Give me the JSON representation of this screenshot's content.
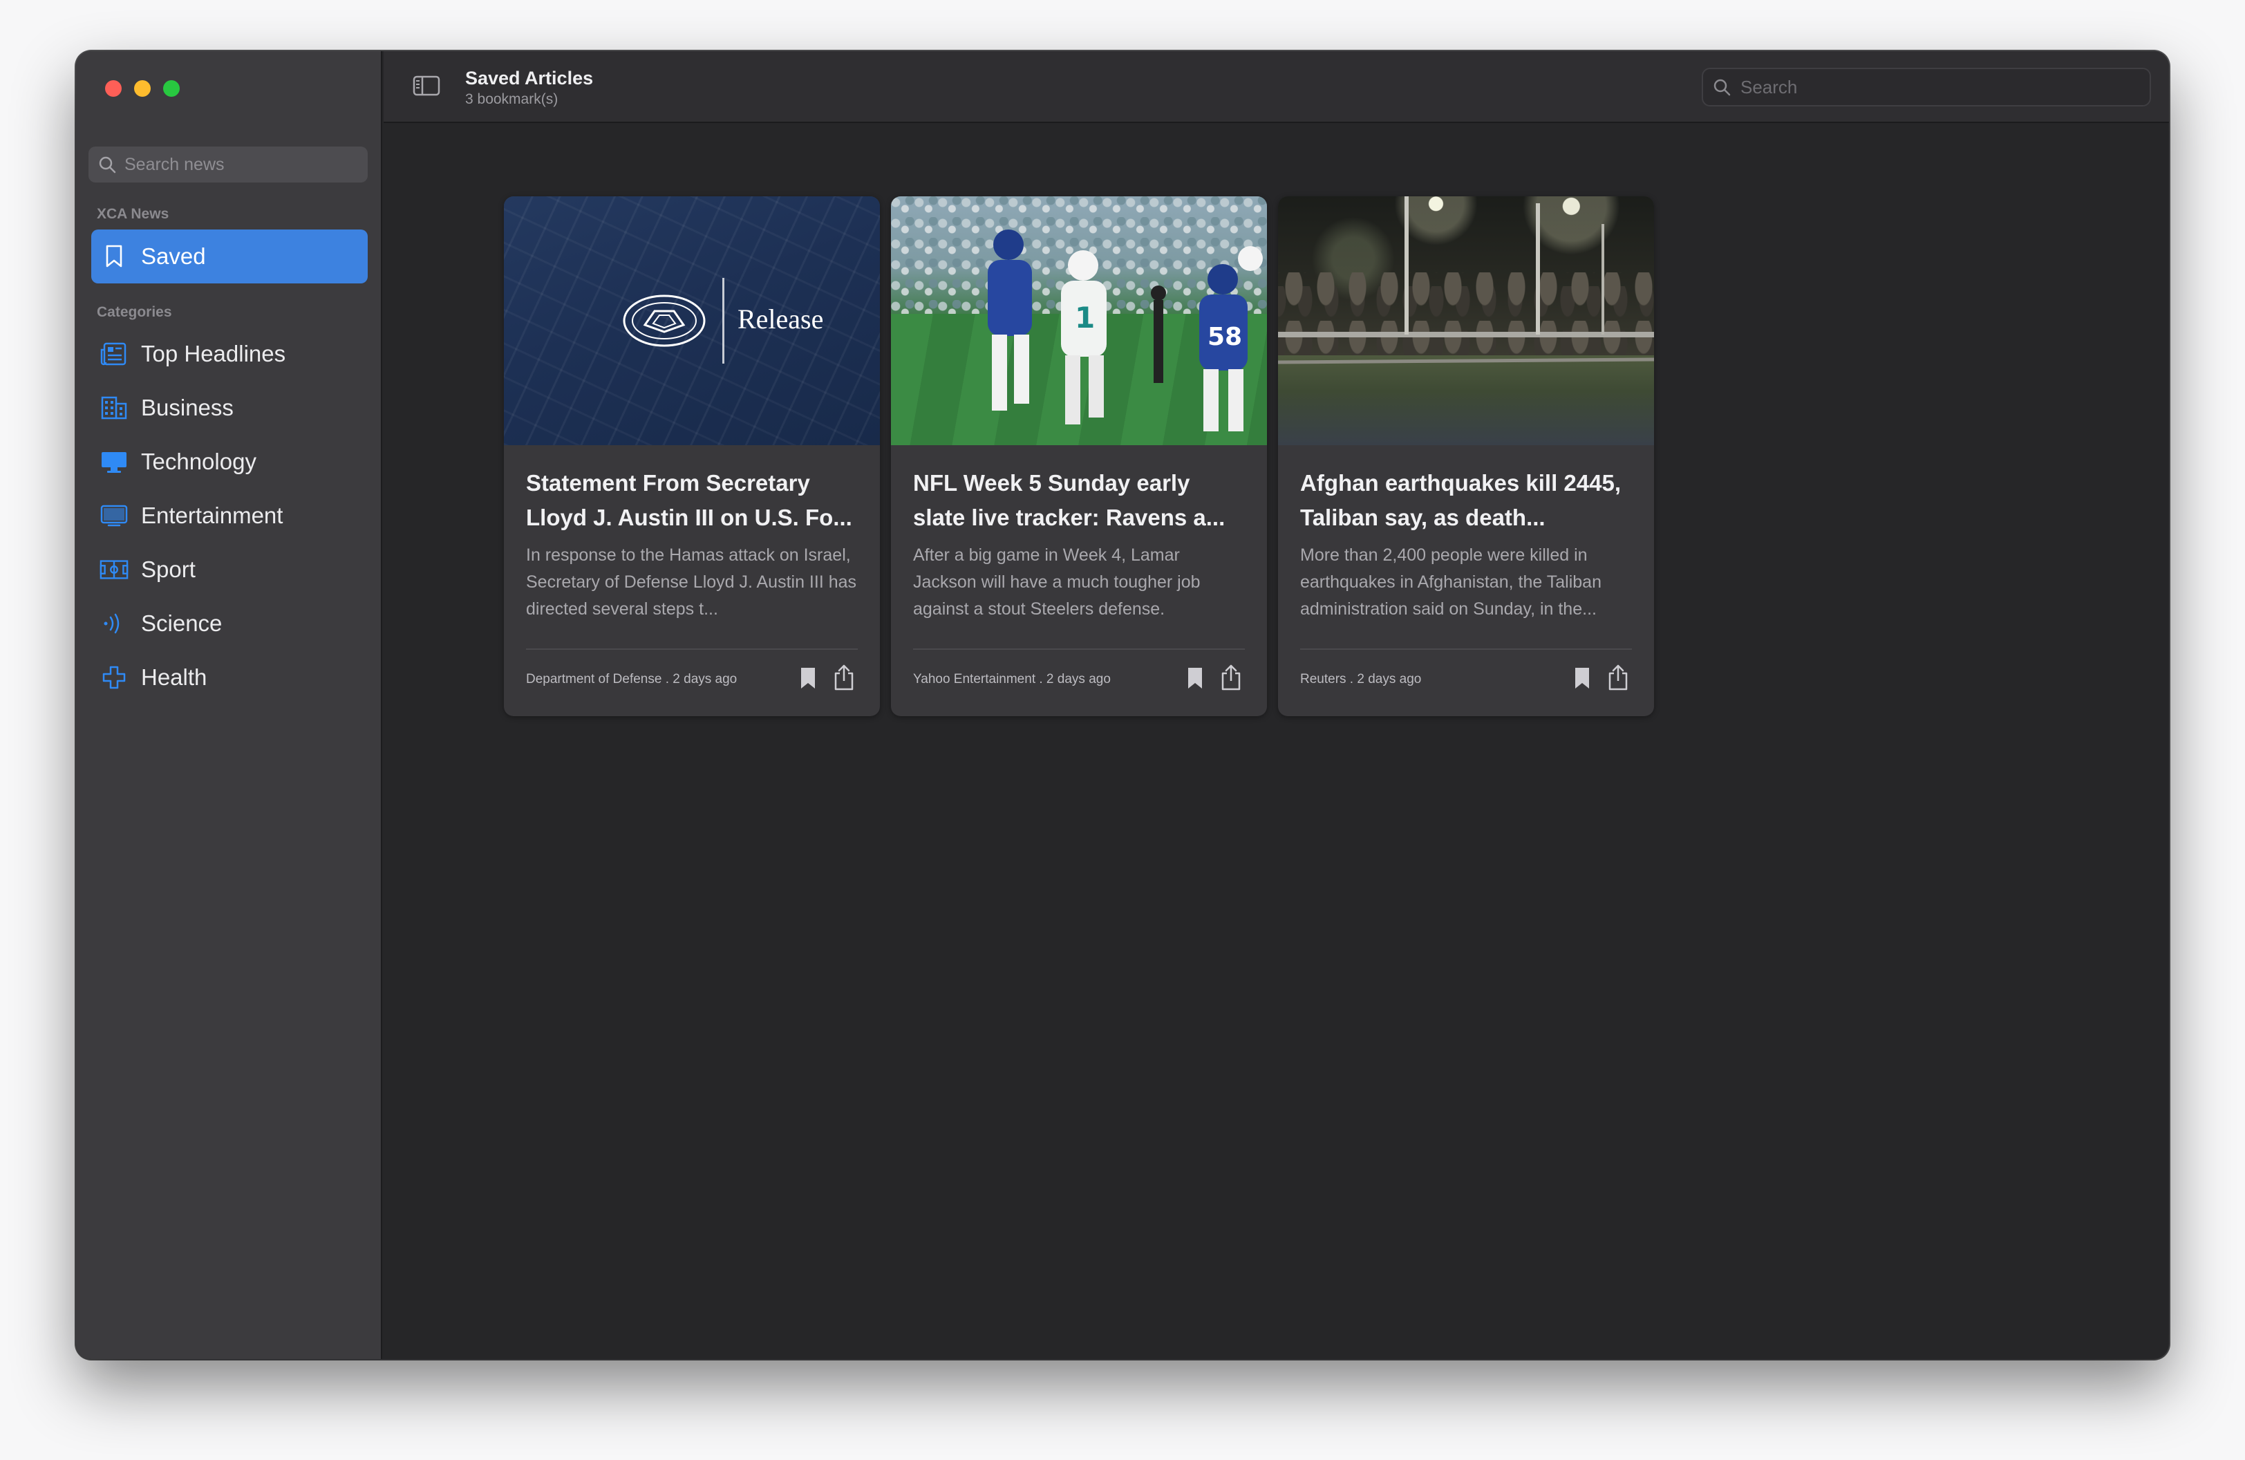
{
  "sidebar": {
    "search_placeholder": "Search news",
    "section_app": "XCA News",
    "saved_label": "Saved",
    "section_categories": "Categories",
    "categories": [
      {
        "label": "Top Headlines",
        "icon": "newspaper-icon"
      },
      {
        "label": "Business",
        "icon": "building-icon"
      },
      {
        "label": "Technology",
        "icon": "desktop-icon"
      },
      {
        "label": "Entertainment",
        "icon": "tv-icon"
      },
      {
        "label": "Sport",
        "icon": "sport-field-icon"
      },
      {
        "label": "Science",
        "icon": "wave-icon"
      },
      {
        "label": "Health",
        "icon": "cross-icon"
      }
    ]
  },
  "toolbar": {
    "title": "Saved Articles",
    "subtitle": "3 bookmark(s)",
    "search_placeholder": "Search"
  },
  "articles": [
    {
      "title": "Statement From Secretary Lloyd J. Austin III on U.S. Fo...",
      "description": "In response to the Hamas attack on Israel, Secretary of Defense Lloyd J. Austin III has directed several steps t...",
      "meta": "Department of Defense . 2 days ago",
      "image_text": "Release"
    },
    {
      "title": "NFL Week 5 Sunday early slate live tracker: Ravens a...",
      "description": "After a big game in Week 4, Lamar Jackson will have a much tougher job against a stout Steelers defense.",
      "meta": "Yahoo Entertainment . 2 days ago"
    },
    {
      "title": "Afghan earthquakes kill 2445, Taliban say, as death...",
      "description": "More than 2,400 people were killed in earthquakes in Afghanistan, the Taliban administration said on Sunday, in the...",
      "meta": "Reuters . 2 days ago"
    }
  ],
  "colors": {
    "accent": "#3d82e0",
    "sidebar_bg": "#3c3b3e",
    "content_bg": "#262628",
    "card_bg": "#39383b",
    "icon_blue": "#2f8af5"
  }
}
